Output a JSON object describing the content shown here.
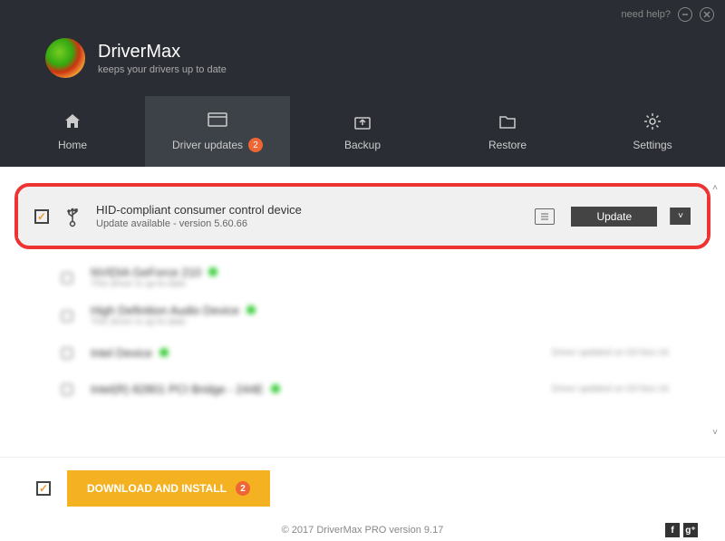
{
  "titlebar": {
    "help": "need help?"
  },
  "brand": {
    "title": "DriverMax",
    "subtitle": "keeps your drivers up to date"
  },
  "nav": {
    "items": [
      {
        "label": "Home"
      },
      {
        "label": "Driver updates",
        "badge": "2"
      },
      {
        "label": "Backup"
      },
      {
        "label": "Restore"
      },
      {
        "label": "Settings"
      }
    ]
  },
  "highlighted_driver": {
    "name": "HID-compliant consumer control device",
    "status": "Update available - version 5.60.66",
    "update_label": "Update"
  },
  "blurred_drivers": [
    {
      "name": "NVIDIA GeForce 210",
      "sub": "This driver is up-to-date"
    },
    {
      "name": "High Definition Audio Device",
      "sub": "This driver is up-to-date"
    },
    {
      "name": "Intel Device",
      "sub": "",
      "right": "Driver updated on 03-Nov-16"
    },
    {
      "name": "Intel(R) 82801 PCI Bridge - 244E",
      "sub": "",
      "right": "Driver updated on 03-Nov-16"
    }
  ],
  "footer": {
    "download_label": "DOWNLOAD AND INSTALL",
    "download_badge": "2"
  },
  "copyright": "© 2017 DriverMax PRO version 9.17"
}
